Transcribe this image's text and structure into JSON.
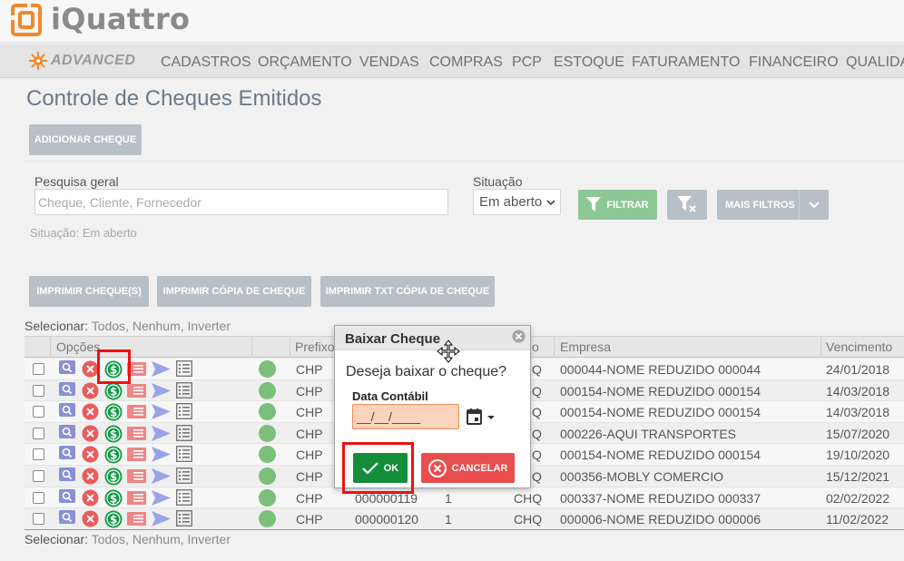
{
  "app": {
    "logo_text": "iQuattro",
    "brand": "ADVANCED",
    "colors": {
      "accent_orange": "#f0892b",
      "ok_green": "#138d3a",
      "cancel_red": "#ea4d4d",
      "filter_green": "#8dc795",
      "status_green": "#7cbf7b",
      "highlight_red": "#ef1010"
    }
  },
  "nav": [
    "CADASTROS",
    "ORÇAMENTO",
    "VENDAS",
    "COMPRAS",
    "PCP",
    "ESTOQUE",
    "FATURAMENTO",
    "FINANCEIRO",
    "QUALIDA"
  ],
  "page": {
    "title": "Controle de Cheques Emitidos",
    "add_button": "ADICIONAR CHEQUE"
  },
  "filters": {
    "search_label": "Pesquisa geral",
    "search_placeholder": "Cheque, Cliente, Fornecedor",
    "situacao_label": "Situação",
    "situacao_value": "Em aberto",
    "filtrar": "FILTRAR",
    "mais_filtros": "MAIS FILTROS",
    "situacao_note": "Situação: Em aberto"
  },
  "print_buttons": {
    "b1": "IMPRIMIR CHEQUE(S)",
    "b2": "IMPRIMIR CÓPIA DE CHEQUE",
    "b3": "IMPRIMIR TXT CÓPIA DE CHEQUE"
  },
  "select": {
    "prefix": "Selecionar:",
    "todos": "Todos,",
    "nenhum": "Nenhum,",
    "inverter": "Inverter"
  },
  "table": {
    "headers": {
      "opcoes": "Opções",
      "prefixo": "Prefixo",
      "tipo_suffix": "o",
      "empresa": "Empresa",
      "vencimento": "Vencimento"
    },
    "rows": [
      {
        "prefixo": "CHP",
        "numero": "",
        "parcela": "",
        "tipo": "Q",
        "empresa": "000044-NOME REDUZIDO 000044",
        "vencimento": "24/01/2018"
      },
      {
        "prefixo": "CHP",
        "numero": "",
        "parcela": "",
        "tipo": "Q",
        "empresa": "000154-NOME REDUZIDO 000154",
        "vencimento": "14/03/2018"
      },
      {
        "prefixo": "CHP",
        "numero": "",
        "parcela": "",
        "tipo": "Q",
        "empresa": "000154-NOME REDUZIDO 000154",
        "vencimento": "14/03/2018"
      },
      {
        "prefixo": "CHP",
        "numero": "",
        "parcela": "",
        "tipo": "Q",
        "empresa": "000226-AQUI TRANSPORTES",
        "vencimento": "15/07/2020"
      },
      {
        "prefixo": "CHP",
        "numero": "",
        "parcela": "",
        "tipo": "Q",
        "empresa": "000154-NOME REDUZIDO 000154",
        "vencimento": "19/10/2020"
      },
      {
        "prefixo": "CHP",
        "numero": "",
        "parcela": "",
        "tipo": "Q",
        "empresa": "000356-MOBLY COMERCIO",
        "vencimento": "15/12/2021"
      },
      {
        "prefixo": "CHP",
        "numero": "000000119",
        "parcela": "1",
        "tipo": "CHQ",
        "empresa": "000337-NOME REDUZIDO 000337",
        "vencimento": "02/02/2022"
      },
      {
        "prefixo": "CHP",
        "numero": "000000120",
        "parcela": "1",
        "tipo": "CHQ",
        "empresa": "000006-NOME REDUZIDO 000006",
        "vencimento": "11/02/2022"
      }
    ]
  },
  "dialog": {
    "title": "Baixar Cheque",
    "message": "Deseja baixar o cheque?",
    "date_label": "Data Contábil",
    "date_value": "__/__/____",
    "ok": "OK",
    "cancel": "CANCELAR"
  }
}
